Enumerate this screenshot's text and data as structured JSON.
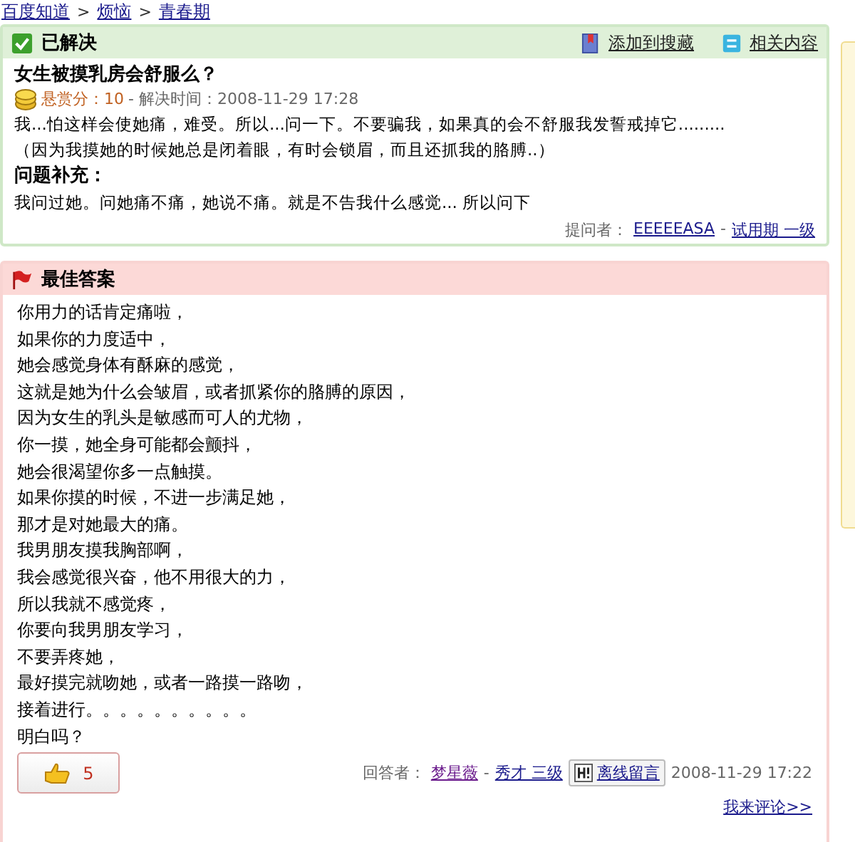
{
  "breadcrumb": {
    "separator": ">",
    "items": [
      {
        "label": "百度知道"
      },
      {
        "label": "烦恼"
      },
      {
        "label": "青春期"
      }
    ]
  },
  "question": {
    "status": "已解决",
    "actions": [
      {
        "kind": "favorite",
        "label": "添加到搜藏"
      },
      {
        "kind": "related",
        "label": "相关内容"
      }
    ],
    "title": "女生被摸乳房会舒服么？",
    "reward": "悬赏分：10",
    "solved_time": "- 解决时间：2008-11-29 17:28",
    "body": [
      "我...怕这样会使她痛，难受。所以...问一下。不要骗我，如果真的会不舒服我发誓戒掉它.........",
      "（因为我摸她的时候她总是闭着眼，有时会锁眉，而且还抓我的胳膊..）"
    ],
    "supplement_label": "问题补充：",
    "supplement": "我问过她。问她痛不痛，她说不痛。就是不告我什么感觉... 所以问下",
    "asker_label": "提问者：",
    "asker": "EEEEEASA",
    "asker_sep": "-",
    "asker_level": "试用期 一级"
  },
  "answer": {
    "title": "最佳答案",
    "lines": [
      "你用力的话肯定痛啦，",
      "如果你的力度适中，",
      "她会感觉身体有酥麻的感觉，",
      "这就是她为什么会皱眉，或者抓紧你的胳膊的原因，",
      "因为女生的乳头是敏感而可人的尤物，",
      "你一摸，她全身可能都会颤抖，",
      "她会很渴望你多一点触摸。",
      "如果你摸的时候，不进一步满足她，",
      "那才是对她最大的痛。",
      "我男朋友摸我胸部啊，",
      "我会感觉很兴奋，他不用很大的力，",
      "所以我就不感觉疼，",
      "你要向我男朋友学习，",
      "不要弄疼她，",
      "最好摸完就吻她，或者一路摸一路吻，",
      "接着进行。。。。。。。。。。",
      "明白吗？"
    ],
    "votes": "5",
    "answerer_label": "回答者：",
    "answerer": "梦星薇",
    "answerer_sep": "-",
    "answerer_level": "秀才 三级",
    "message_button": "离线留言",
    "time": "2008-11-29 17:22",
    "comment_link": "我来评论>>"
  }
}
